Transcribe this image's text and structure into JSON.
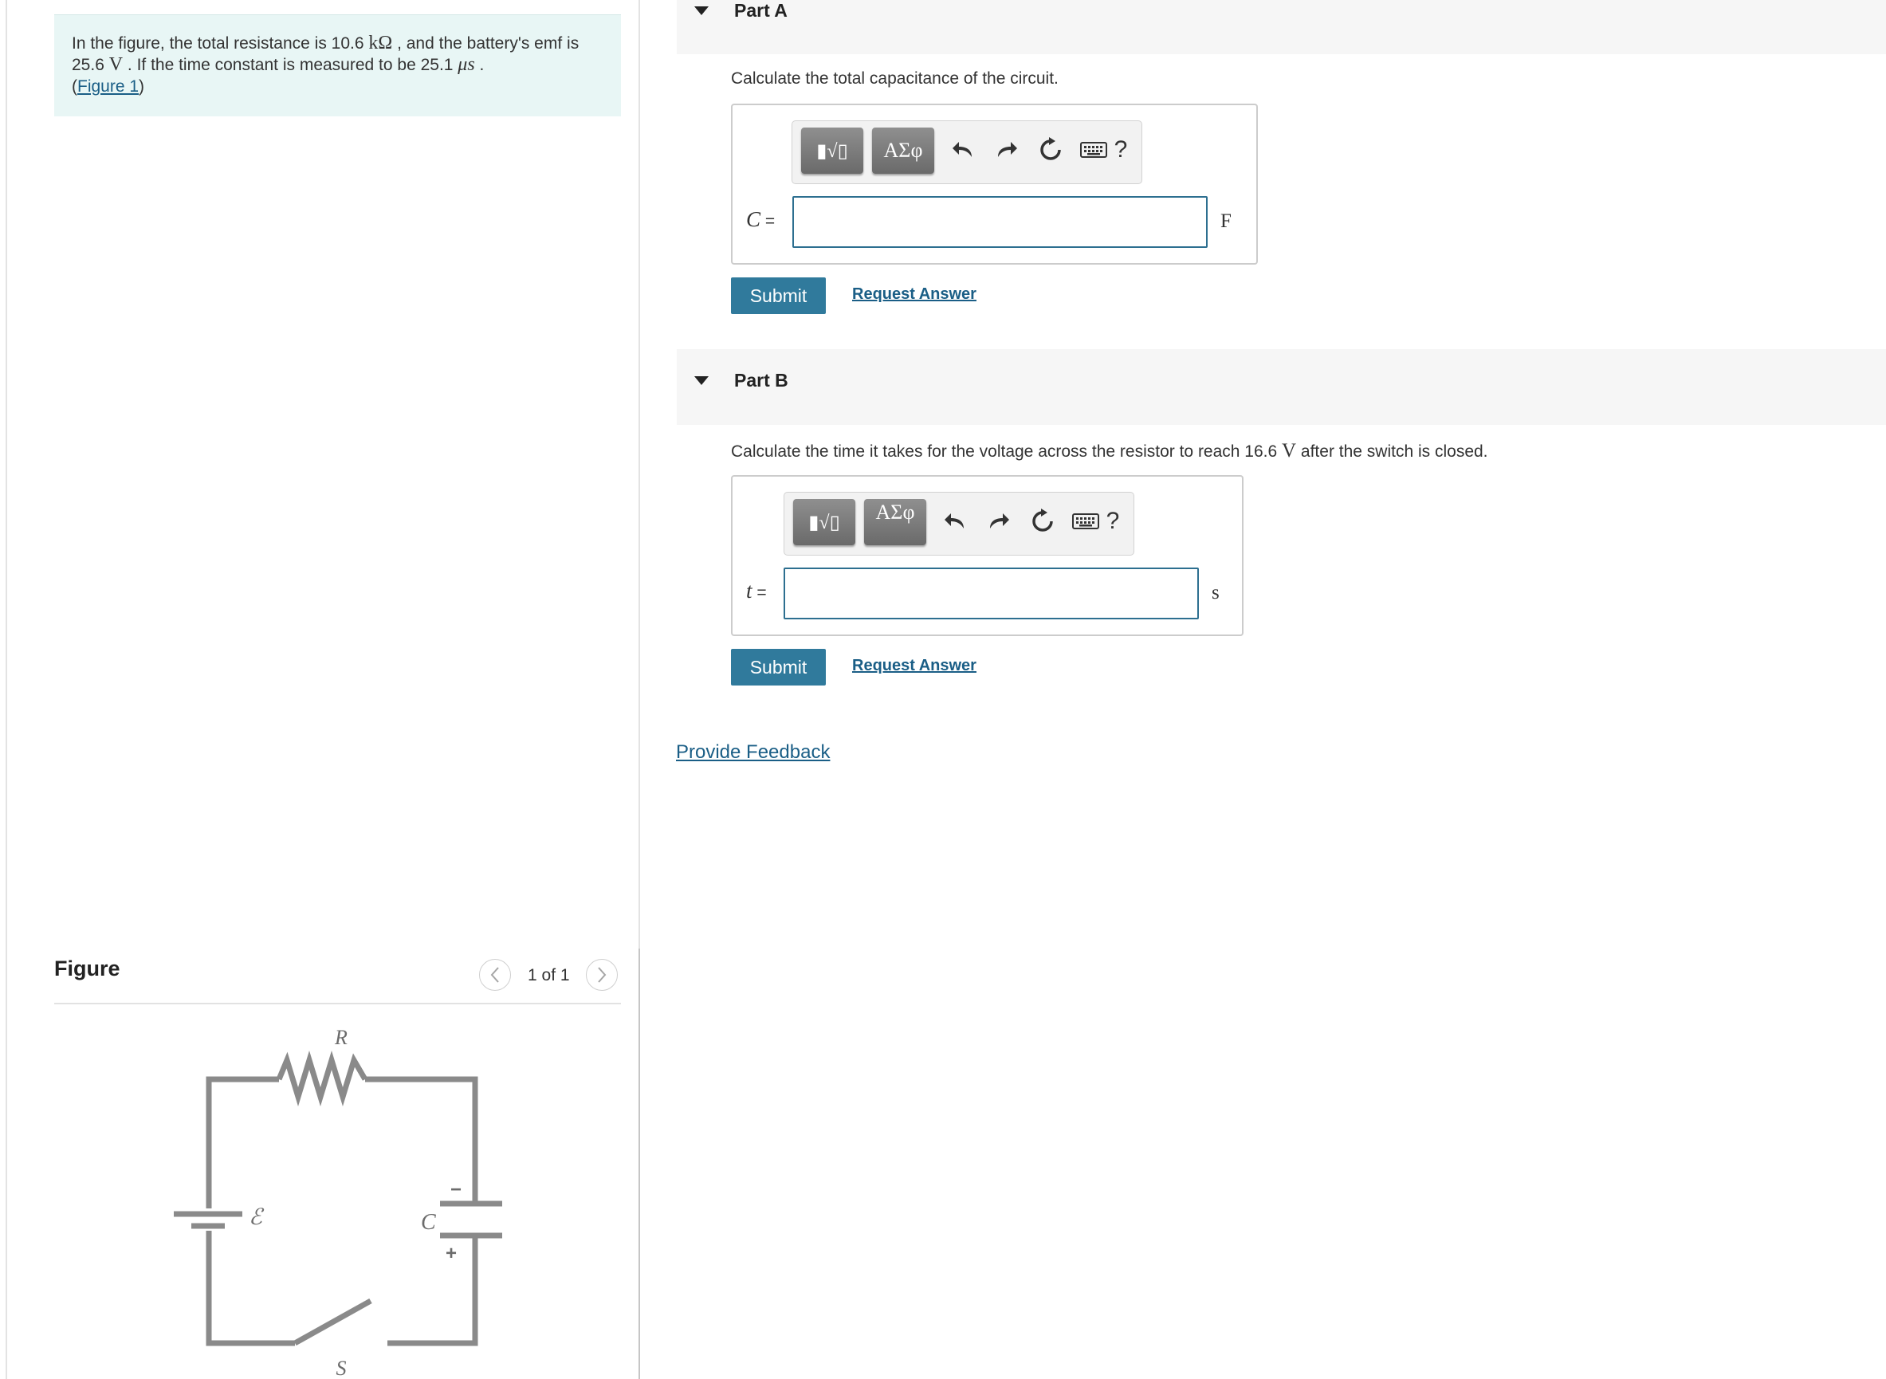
{
  "statement": {
    "text1": "In the figure, the total resistance is 10.6 ",
    "resistance_unit": "kΩ",
    "text2": " , and the battery's emf is 25.6 ",
    "emf_unit": "V",
    "text3": " . If the time constant is measured to be 25.1 ",
    "time_unit": "μs",
    "text4": " .",
    "figure_link_open": "(",
    "figure_link": "Figure 1",
    "figure_link_close": ")"
  },
  "figure": {
    "title": "Figure",
    "pager": "1 of 1",
    "prev_icon": "chevron-left-icon",
    "next_icon": "chevron-right-icon",
    "labels": {
      "R": "R",
      "emf": "ℰ",
      "C": "C",
      "S": "S",
      "minus": "−",
      "plus": "+"
    }
  },
  "part_a": {
    "title": "Part A",
    "prompt": "Calculate the total capacitance of the circuit.",
    "var": "C",
    "eq": " =",
    "value": "",
    "unit": "F",
    "toolbar": {
      "templates": "▮√▯",
      "greek": "ΑΣφ",
      "help": "?"
    },
    "submit": "Submit",
    "request": "Request Answer"
  },
  "part_b": {
    "title": "Part B",
    "prompt1": "Calculate the time it takes for the voltage across the resistor to reach 16.6 ",
    "prompt_unit": "V",
    "prompt2": " after the switch is closed.",
    "var": "t",
    "eq": " =",
    "value": "",
    "unit": "s",
    "toolbar": {
      "templates": "▮√▯",
      "greek": "ΑΣφ",
      "help": "?"
    },
    "submit": "Submit",
    "request": "Request Answer"
  },
  "feedback": "Provide Feedback",
  "colors": {
    "accent": "#307a9c",
    "link": "#1a5e86",
    "statement_bg": "#e8f6f5",
    "input_border": "#2d6f90"
  }
}
